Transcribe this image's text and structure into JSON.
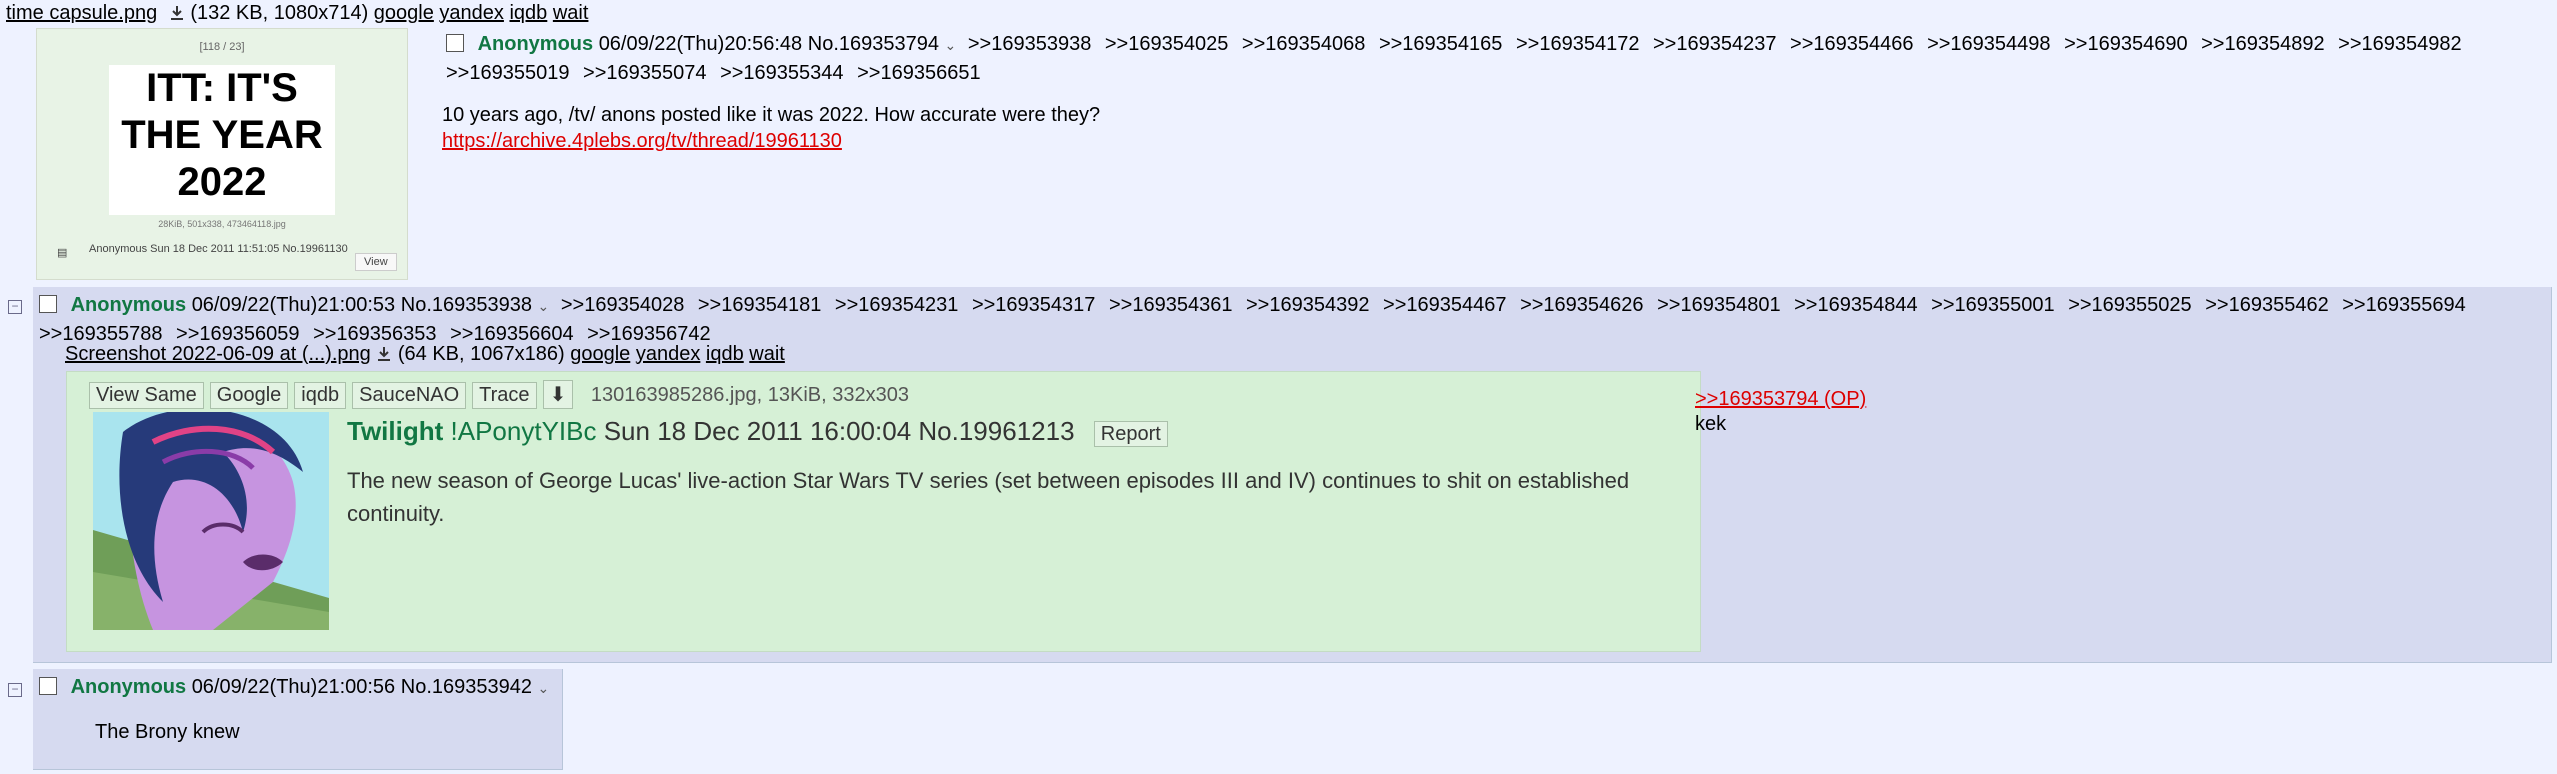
{
  "op": {
    "file_name": "time capsule.png",
    "file_meta": "(132 KB, 1080x714)",
    "search_links": [
      "google",
      "yandex",
      "iqdb",
      "wait"
    ],
    "thumb": {
      "counter": "[118 / 23]",
      "lines": [
        "ITT: IT'S",
        "THE YEAR",
        "2022"
      ],
      "caption": "28KiB, 501x338, 473464118.jpg",
      "post_info": "Anonymous Sun 18 Dec 2011 11:51:05 No.19961130",
      "view_label": "View"
    },
    "name": "Anonymous",
    "datetime": "06/09/22(Thu)20:56:48",
    "post_no": "No.169353794",
    "replies": [
      ">>169353938",
      ">>169354025",
      ">>169354068",
      ">>169354165",
      ">>169354172",
      ">>169354237",
      ">>169354466",
      ">>169354498",
      ">>169354690",
      ">>169354892",
      ">>169354982",
      ">>169355019",
      ">>169355074",
      ">>169355344",
      ">>169356651"
    ],
    "message": "10 years ago, /tv/ anons posted like it was 2022. How accurate were they?",
    "message_link": "https://archive.4plebs.org/tv/thread/19961130"
  },
  "reply1": {
    "name": "Anonymous",
    "datetime": "06/09/22(Thu)21:00:53",
    "post_no": "No.169353938",
    "replies": [
      ">>169354028",
      ">>169354181",
      ">>169354231",
      ">>169354317",
      ">>169354361",
      ">>169354392",
      ">>169354467",
      ">>169354626",
      ">>169354801",
      ">>169354844",
      ">>169355001",
      ">>169355025",
      ">>169355462",
      ">>169355694",
      ">>169355788",
      ">>169356059",
      ">>169356353",
      ">>169356604",
      ">>169356742"
    ],
    "file_name": "Screenshot 2022-06-09 at (...).png",
    "file_meta": "(64 KB, 1067x186)",
    "search_links": [
      "google",
      "yandex",
      "iqdb",
      "wait"
    ],
    "embed": {
      "buttons": [
        "View Same",
        "Google",
        "iqdb",
        "SauceNAO",
        "Trace"
      ],
      "file_info": "130163985286.jpg, 13KiB, 332x303",
      "name": "Twilight",
      "tripcode": "!APonytYIBc",
      "datetime": "Sun 18 Dec 2011 16:00:04",
      "post_no": "No.19961213",
      "report_label": "Report",
      "message": "The new season of George Lucas' live-action Star Wars TV series (set between episodes III and IV) continues to shit on established continuity."
    },
    "quote_link": ">>169353794 (OP)",
    "message": "kek"
  },
  "reply2": {
    "name": "Anonymous",
    "datetime": "06/09/22(Thu)21:00:56",
    "post_no": "No.169353942",
    "message": "The Brony knew"
  },
  "colors": {
    "background": "#eef2ff",
    "reply_bg": "#d6daf0",
    "name_green": "#117743",
    "embed_bg": "#d6f0d6",
    "link_red": "#dd0000"
  }
}
